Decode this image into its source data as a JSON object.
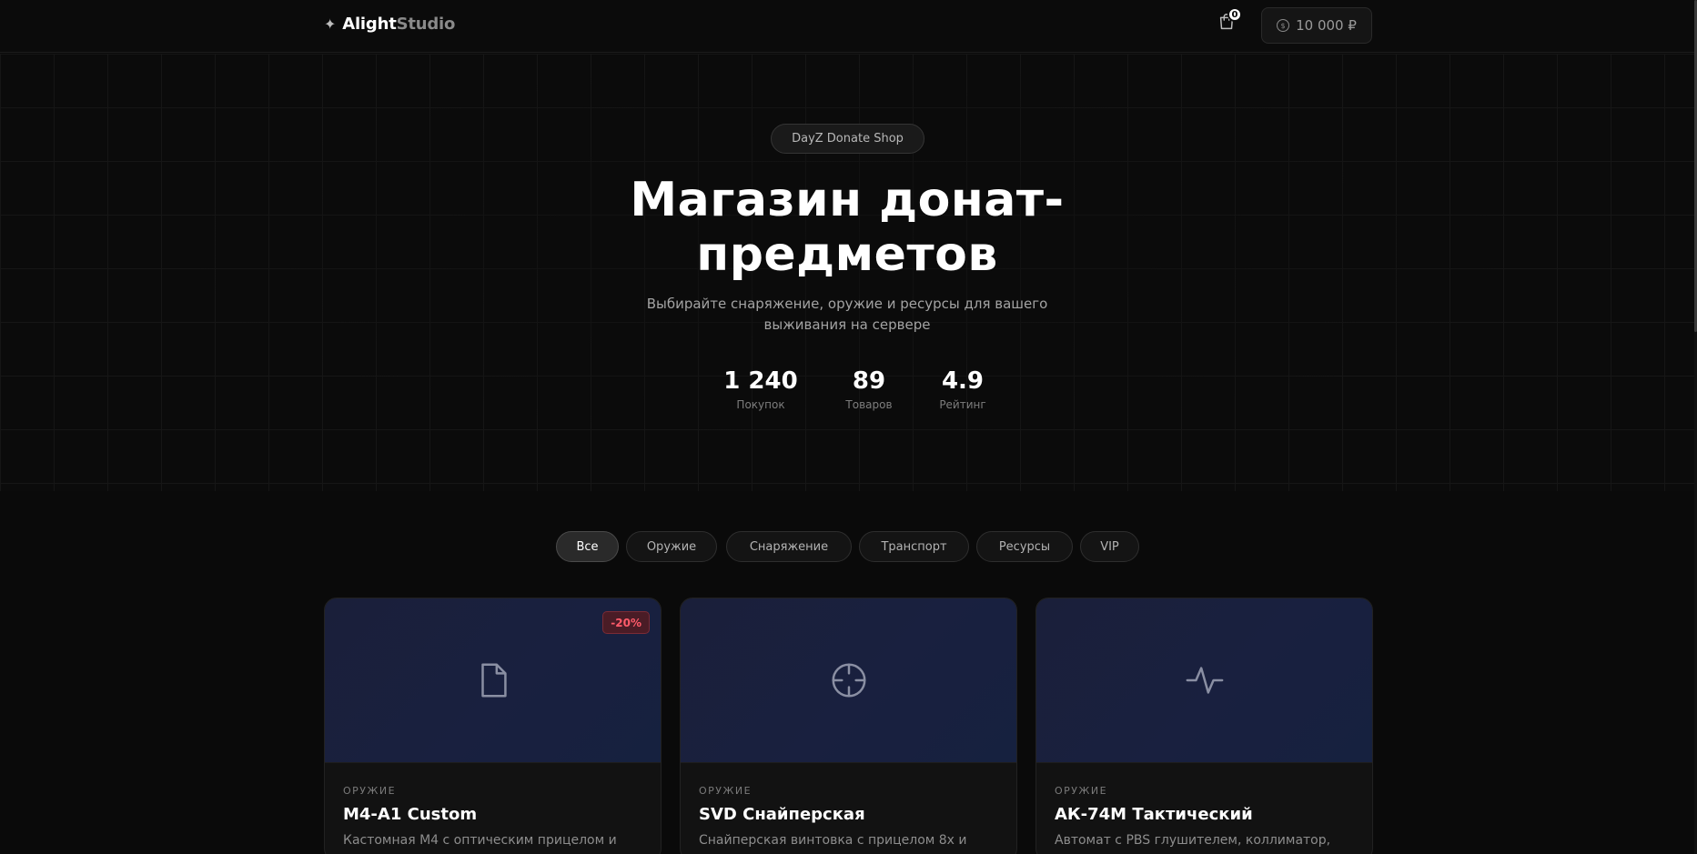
{
  "header": {
    "logo_mark": "✦",
    "logo_main": "Alight",
    "logo_sub": "Studio",
    "cart_count": "0",
    "balance": "10 000 ₽"
  },
  "hero": {
    "badge": "DayZ Donate Shop",
    "title_line1": "Магазин донат-",
    "title_line2": "предметов",
    "subtitle_line1": "Выбирайте снаряжение, оружие и ресурсы для вашего",
    "subtitle_line2": "выживания на сервере",
    "stats": [
      {
        "value": "1 240",
        "label": "Покупок"
      },
      {
        "value": "89",
        "label": "Товаров"
      },
      {
        "value": "4.9",
        "label": "Рейтинг"
      }
    ]
  },
  "filters": {
    "active": "Все",
    "items": [
      "Все",
      "Оружие",
      "Снаряжение",
      "Транспорт",
      "Ресурсы",
      "VIP"
    ]
  },
  "products": [
    {
      "category": "ОРУЖИЕ",
      "name": "M4-A1 Custom",
      "description": "Кастомная M4 с оптическим прицелом и",
      "discount": "-20%",
      "icon": "document-icon"
    },
    {
      "category": "ОРУЖИЕ",
      "name": "SVD Снайперская",
      "description": "Снайперская винтовка с прицелом 8x и",
      "discount": "",
      "icon": "crosshair-icon"
    },
    {
      "category": "ОРУЖИЕ",
      "name": "АК-74М Тактический",
      "description": "Автомат с PBS глушителем, коллиматор,",
      "discount": "",
      "icon": "pulse-icon"
    }
  ],
  "colors": {
    "background": "#0a0a0a",
    "card_media": "#1a1f3a",
    "discount_text": "#ff5b6a"
  }
}
